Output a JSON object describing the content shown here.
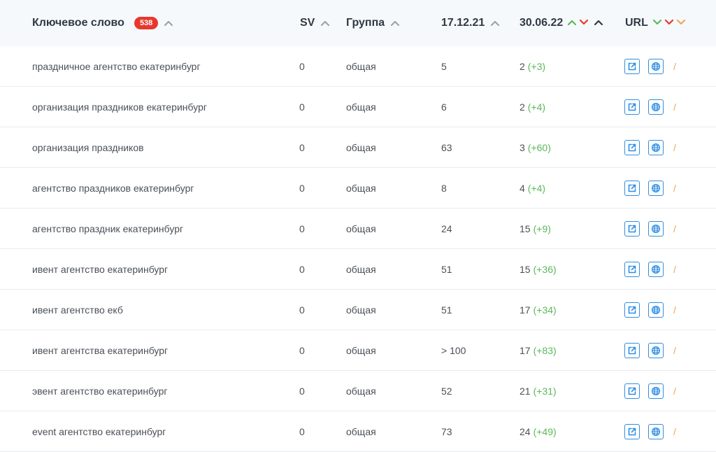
{
  "header": {
    "keyword_label": "Ключевое слово",
    "keyword_count": "538",
    "sv_label": "SV",
    "group_label": "Группа",
    "date1_label": "17.12.21",
    "date2_label": "30.06.22",
    "url_label": "URL"
  },
  "colors": {
    "up_green": "#5cb85c",
    "down_red": "#e8382d",
    "link_blue": "#2f8ee6",
    "slash_orange": "#f0a55a"
  },
  "rows": [
    {
      "keyword": "праздничное агентство екатеринбург",
      "sv": "0",
      "group": "общая",
      "pos1": "5",
      "pos2": "2",
      "delta": "(+3)",
      "slash": "/"
    },
    {
      "keyword": "организация праздников екатеринбург",
      "sv": "0",
      "group": "общая",
      "pos1": "6",
      "pos2": "2",
      "delta": "(+4)",
      "slash": "/"
    },
    {
      "keyword": "организация праздников",
      "sv": "0",
      "group": "общая",
      "pos1": "63",
      "pos2": "3",
      "delta": "(+60)",
      "slash": "/"
    },
    {
      "keyword": "агентство праздников екатеринбург",
      "sv": "0",
      "group": "общая",
      "pos1": "8",
      "pos2": "4",
      "delta": "(+4)",
      "slash": "/"
    },
    {
      "keyword": "агентство праздник екатеринбург",
      "sv": "0",
      "group": "общая",
      "pos1": "24",
      "pos2": "15",
      "delta": "(+9)",
      "slash": "/"
    },
    {
      "keyword": "ивент агентство екатеринбург",
      "sv": "0",
      "group": "общая",
      "pos1": "51",
      "pos2": "15",
      "delta": "(+36)",
      "slash": "/"
    },
    {
      "keyword": "ивент агентство екб",
      "sv": "0",
      "group": "общая",
      "pos1": "51",
      "pos2": "17",
      "delta": "(+34)",
      "slash": "/"
    },
    {
      "keyword": "ивент агентства екатеринбург",
      "sv": "0",
      "group": "общая",
      "pos1": "> 100",
      "pos2": "17",
      "delta": "(+83)",
      "slash": "/"
    },
    {
      "keyword": "эвент агентство екатеринбург",
      "sv": "0",
      "group": "общая",
      "pos1": "52",
      "pos2": "21",
      "delta": "(+31)",
      "slash": "/"
    },
    {
      "keyword": "event агентство екатеринбург",
      "sv": "0",
      "group": "общая",
      "pos1": "73",
      "pos2": "24",
      "delta": "(+49)",
      "slash": "/"
    }
  ]
}
